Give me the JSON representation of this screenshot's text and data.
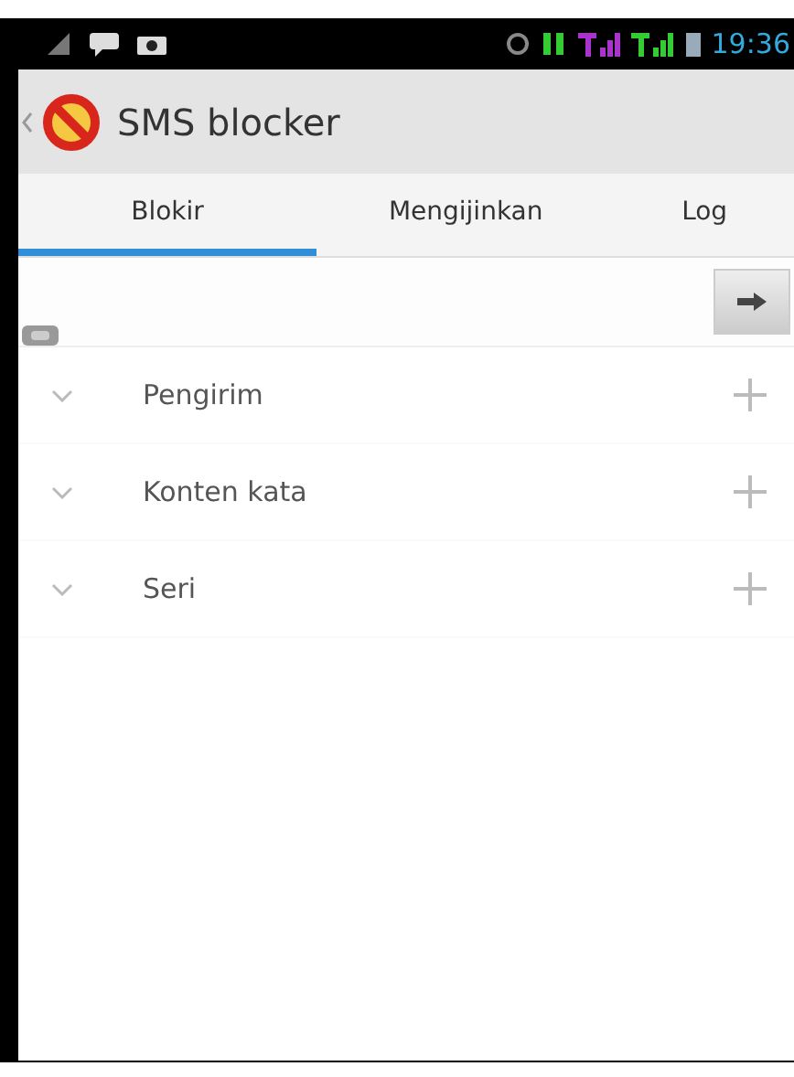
{
  "status_bar": {
    "time": "19:36"
  },
  "app_bar": {
    "title": "SMS blocker"
  },
  "tabs": [
    {
      "label": "Blokir",
      "selected": true
    },
    {
      "label": "Mengijinkan",
      "selected": false
    },
    {
      "label": "Log",
      "selected": false
    }
  ],
  "groups": [
    {
      "label": "Pengirim",
      "expanded": false
    },
    {
      "label": "Konten kata",
      "expanded": false
    },
    {
      "label": "Seri",
      "expanded": false
    }
  ]
}
